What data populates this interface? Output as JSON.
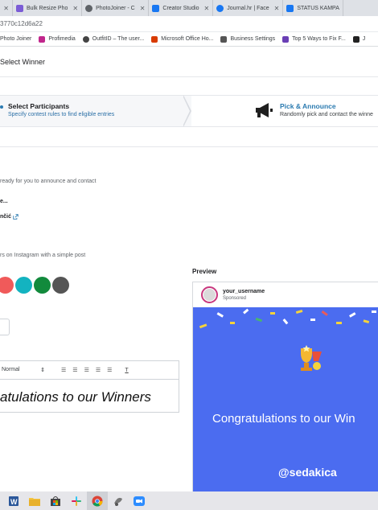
{
  "browser": {
    "tabs": [
      {
        "label": "",
        "color": "#9aa0a6"
      },
      {
        "label": "Bulk Resize Pho",
        "color": "#7b5cd6"
      },
      {
        "label": "PhotoJoiner - C",
        "color": "#5f6368"
      },
      {
        "label": "Creator Studio",
        "color": "#1877f2"
      },
      {
        "label": "Journal.hr | Face",
        "color": "#1877f2"
      },
      {
        "label": "STATUS KAMPA",
        "color": "#1877f2"
      }
    ],
    "url": "3770c12d6a22",
    "bookmarks": [
      {
        "label": "Photo Joiner",
        "color": "#777777"
      },
      {
        "label": "Profimedia",
        "color": "#c1268c"
      },
      {
        "label": "OutfitID – The user...",
        "color": "#444444"
      },
      {
        "label": "Microsoft Office Ho...",
        "color": "#d83b01"
      },
      {
        "label": "Business Settings",
        "color": "#555555"
      },
      {
        "label": "Top 5 Ways to Fix F...",
        "color": "#6a3fb5"
      },
      {
        "label": "J",
        "color": "#222222"
      }
    ]
  },
  "header": {
    "title": "Select Winner"
  },
  "steps": [
    {
      "title": "Select Participants",
      "subtitle": "Specify contest rules to find eligible entries"
    },
    {
      "title": "Pick & Announce",
      "subtitle": "Randomly pick and contact the winne"
    }
  ],
  "content": {
    "ready_text": "ready for you to announce and contact",
    "winner_partial": "e...",
    "winner_name_partial": "nčić",
    "share_text": "rs on Instagram with a simple post",
    "swatches": [
      "#f05a5a",
      "#13b3c0",
      "#128a3c",
      "#555555"
    ],
    "editor": {
      "format_label": "Normal",
      "text": "atulations to our Winners"
    }
  },
  "preview": {
    "label": "Preview",
    "username": "your_username",
    "sponsored": "Sponsored",
    "congrats": "Congratulations to our Win",
    "handle": "@sedakica",
    "bg_color": "#4b6cf0"
  },
  "taskbar": {
    "icons": [
      "word-icon",
      "file-explorer-icon",
      "store-icon",
      "slack-icon",
      "chrome-icon",
      "app-icon",
      "zoom-icon"
    ]
  }
}
